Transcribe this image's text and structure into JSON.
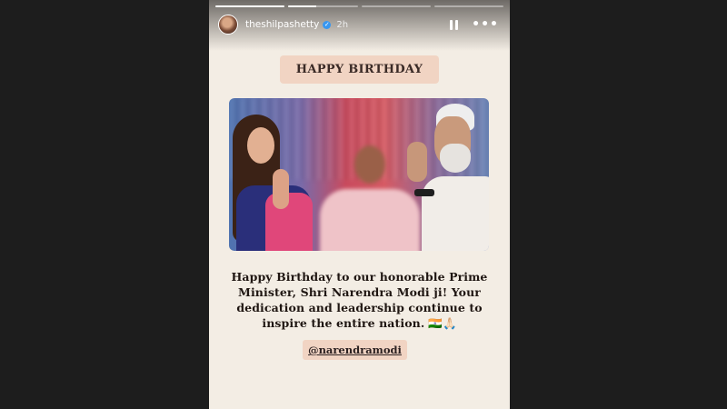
{
  "story": {
    "progress": [
      1,
      0.4,
      0,
      0
    ],
    "username": "theshilpashetty",
    "time": "2h",
    "verified_icon": "✓",
    "pause_icon": "pause-icon",
    "more_icon": "•••"
  },
  "content": {
    "title": "HAPPY BIRTHDAY",
    "message": "Happy Birthday to our honorable Prime Minister, Shri Narendra Modi ji! Your dedication and leadership continue to inspire the entire nation.",
    "emoji": "🇮🇳🙏🏻",
    "mention": "@narendramodi"
  },
  "colors": {
    "background": "#f3ede4",
    "badge": "#f1d4c3"
  }
}
